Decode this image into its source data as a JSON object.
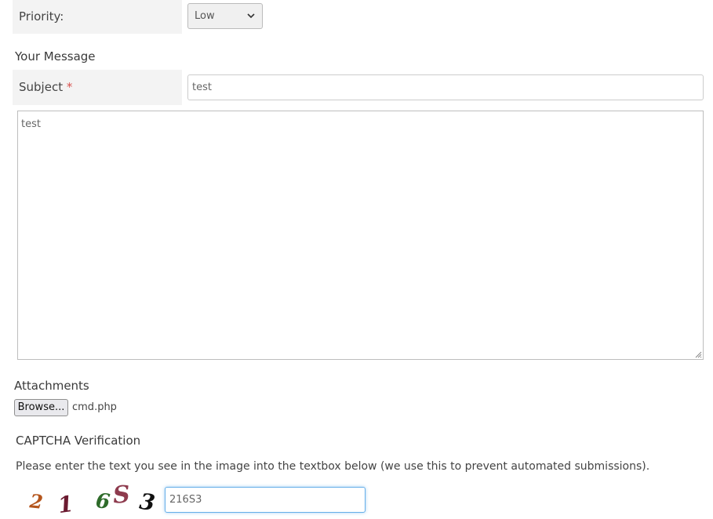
{
  "priority": {
    "label": "Priority:",
    "selected": "Low"
  },
  "message_section": {
    "heading": "Your Message",
    "subject_label": "Subject",
    "required_marker": "*",
    "subject_value": "test",
    "message_value": "test"
  },
  "attachments": {
    "heading": "Attachments",
    "browse_label": "Browse...",
    "file_name": "cmd.php"
  },
  "captcha": {
    "heading": "CAPTCHA Verification",
    "instructions": "Please enter the text you see in the image into the textbox below (we use this to prevent automated submissions).",
    "image_text": "216S3",
    "input_value": "216S3"
  },
  "colors": {
    "required": "#d9534f",
    "focus_border": "#66afe9",
    "label_background": "#f3f3f3"
  },
  "icons": {
    "select_arrow": "chevron-down-icon",
    "textarea_resize": "resize-grip-icon"
  }
}
